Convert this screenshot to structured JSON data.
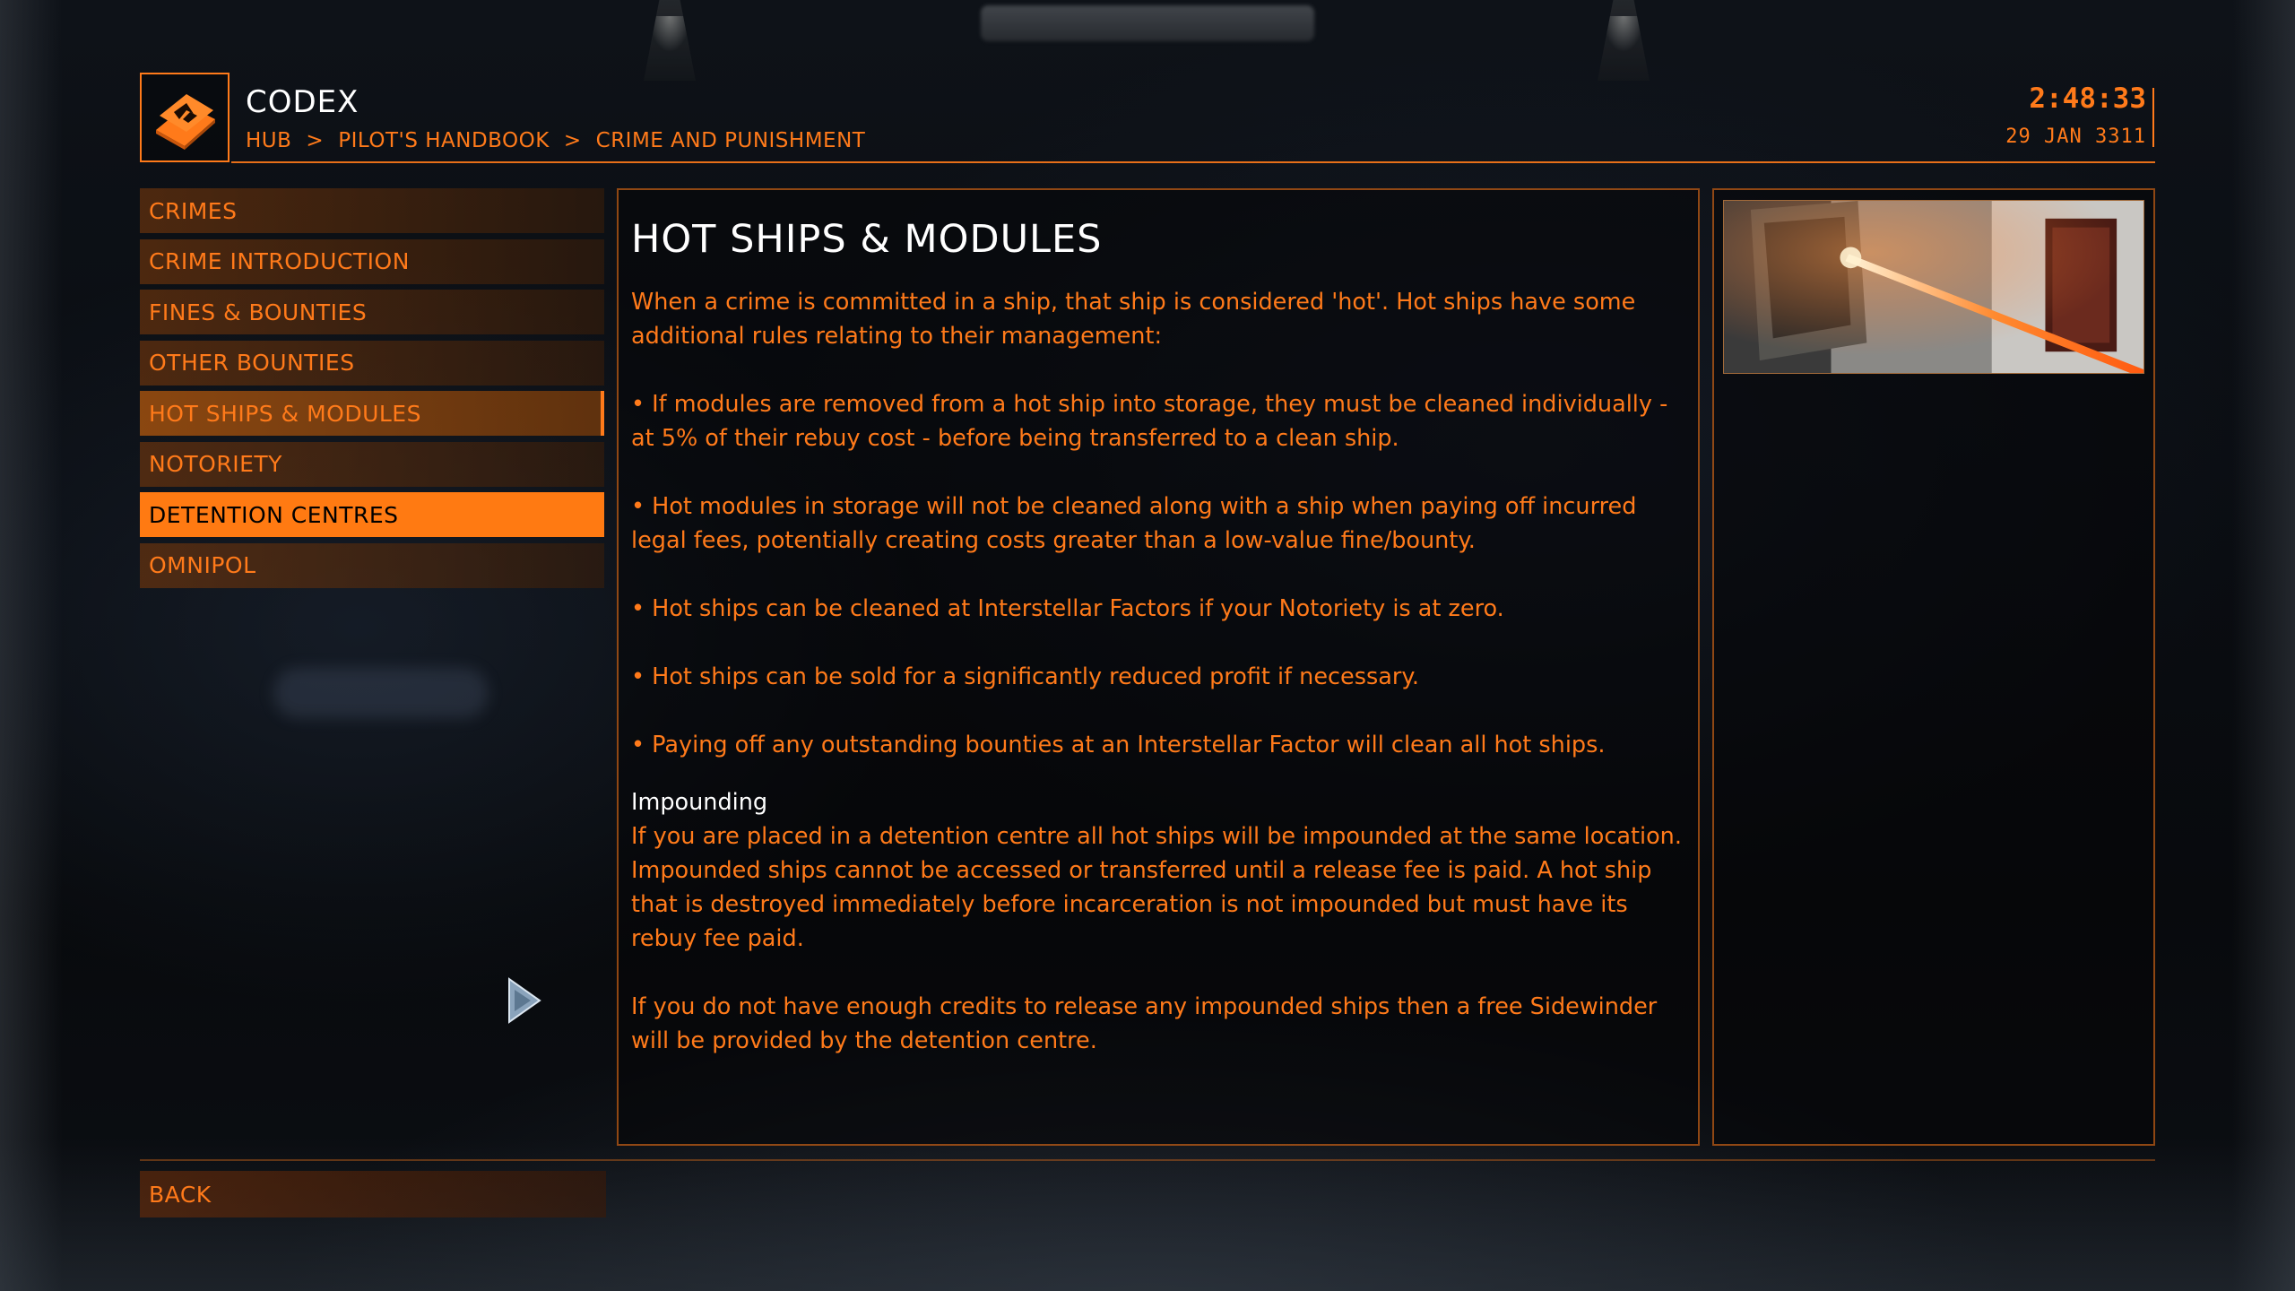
{
  "header": {
    "title": "CODEX",
    "breadcrumbs": [
      "HUB",
      "PILOT'S HANDBOOK",
      "CRIME AND PUNISHMENT"
    ],
    "breadcrumb_separator": ">",
    "time": "2:48:33",
    "date": "29 JAN 3311"
  },
  "sidebar": {
    "items": [
      {
        "label": "CRIMES",
        "state": "normal"
      },
      {
        "label": "CRIME INTRODUCTION",
        "state": "normal"
      },
      {
        "label": "FINES & BOUNTIES",
        "state": "normal"
      },
      {
        "label": "OTHER BOUNTIES",
        "state": "normal"
      },
      {
        "label": "HOT SHIPS & MODULES",
        "state": "hover"
      },
      {
        "label": "NOTORIETY",
        "state": "normal"
      },
      {
        "label": "DETENTION CENTRES",
        "state": "active"
      },
      {
        "label": "OMNIPOL",
        "state": "normal"
      }
    ]
  },
  "article": {
    "title": "HOT SHIPS & MODULES",
    "intro": "When a crime is committed in a ship, that ship is considered 'hot'. Hot ships have some additional rules relating to their management:",
    "bullets": [
      "• If modules are removed from a hot ship into storage, they must be cleaned individually - at 5% of their rebuy cost - before being transferred to a clean ship.",
      "• Hot modules in storage will not be cleaned along with a ship when paying off incurred legal fees, potentially creating costs greater than a low-value fine/bounty.",
      "• Hot ships can be cleaned at Interstellar Factors if your Notoriety is at zero.",
      "• Hot ships can be sold for a significantly reduced profit if necessary.",
      "• Paying off any outstanding bounties at an Interstellar Factor will clean all hot ships."
    ],
    "subheading": "Impounding",
    "impound_text": "If you are placed in a detention centre all hot ships will be impounded at the same location. Impounded ships cannot be accessed or transferred until a release fee is paid. A hot ship that is destroyed immediately before incarceration is not impounded but must have its rebuy fee paid.",
    "closing": "If you do not have enough credits to release any impounded ships then a free Sidewinder will be provided by the detention centre."
  },
  "footer": {
    "back_label": "BACK"
  },
  "icons": {
    "logo": "codex-book-icon",
    "cursor": "mouse-pointer-icon"
  },
  "colors": {
    "accent": "#ff7a1a",
    "active_bg": "#ff7a12",
    "text_white": "#ffffff",
    "background": "#07090c"
  }
}
